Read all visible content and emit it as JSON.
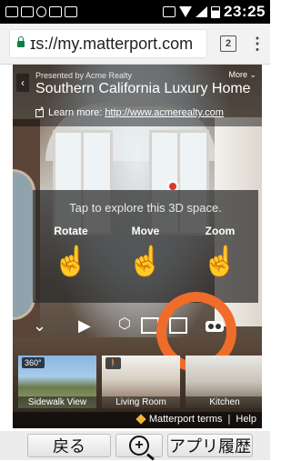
{
  "status_bar": {
    "time": "23:25",
    "left_icons": [
      "message-icon",
      "mail-icon",
      "notification-icon",
      "photo-icon",
      "news-icon"
    ],
    "right_icons": [
      "cast-icon",
      "wifi-icon",
      "signal-icon",
      "battery-icon"
    ]
  },
  "browser": {
    "url": "ɪs://my.matterport.com",
    "tab_count": "2",
    "menu_icon": "overflow-menu-icon"
  },
  "viewer": {
    "presented_by": "Presented by Acme Realty",
    "more": "More ⌄",
    "title": "Southern California Luxury Home",
    "learn_more_prefix": "Learn more:",
    "learn_more_link": "http://www.acmerealty.com",
    "tutorial_text": "Tap to explore this 3D space.",
    "gestures": [
      {
        "label": "Rotate",
        "icon": "rotate-gesture-icon"
      },
      {
        "label": "Move",
        "icon": "move-gesture-icon"
      },
      {
        "label": "Zoom",
        "icon": "zoom-gesture-icon"
      }
    ],
    "thumbnails": [
      {
        "badge": "360°",
        "caption": "Sidewalk View"
      },
      {
        "badge": "🚶",
        "caption": "Living Room"
      },
      {
        "badge": "",
        "caption": "Kitchen"
      }
    ],
    "terms": "Matterport terms",
    "help": "Help",
    "annotation_color": "#f06c2a"
  },
  "bottom_nav": {
    "back_label": "戻る",
    "history_label": "アプリ履歴",
    "zoom_icon": "zoom-in-icon"
  }
}
